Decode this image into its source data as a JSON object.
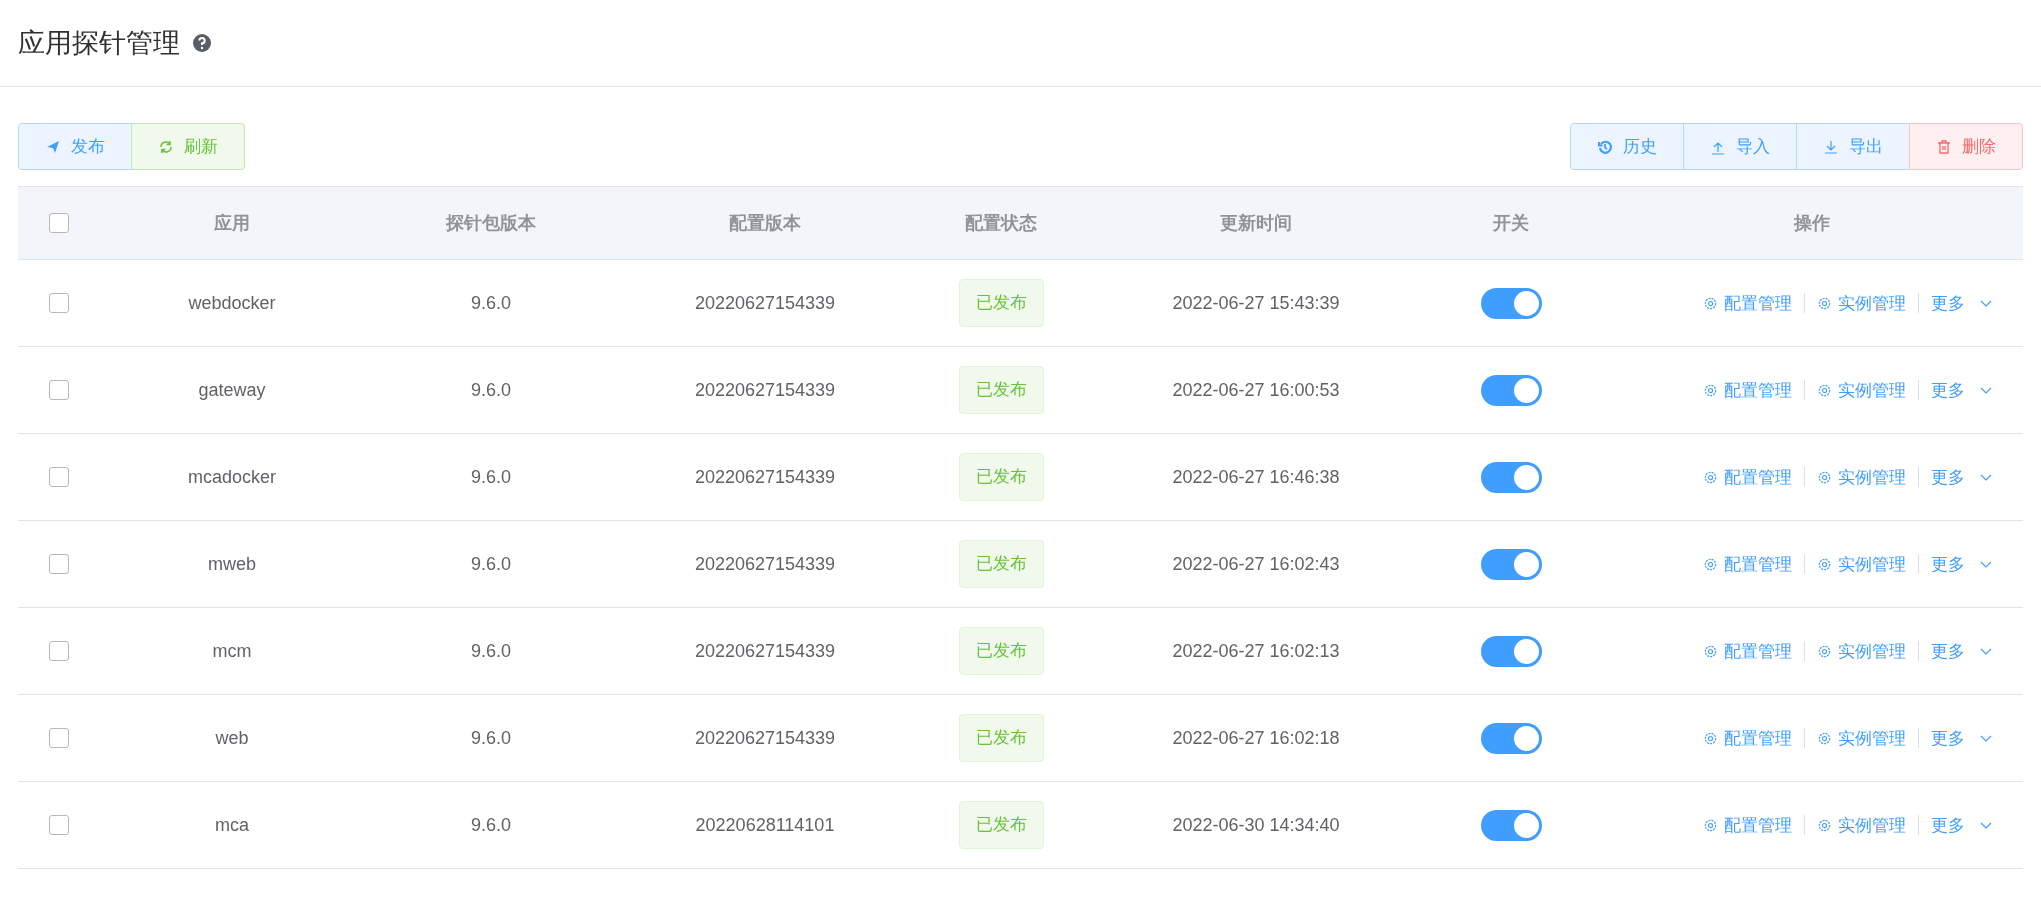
{
  "header": {
    "title": "应用探针管理"
  },
  "toolbar_left": [
    {
      "kind": "publish",
      "label": "发布"
    },
    {
      "kind": "refresh",
      "label": "刷新"
    }
  ],
  "toolbar_right": [
    {
      "kind": "history",
      "label": "历史"
    },
    {
      "kind": "import",
      "label": "导入"
    },
    {
      "kind": "export",
      "label": "导出"
    },
    {
      "kind": "delete",
      "label": "删除"
    }
  ],
  "table": {
    "select_all": {
      "checked": false
    },
    "columns": [
      "应用",
      "探针包版本",
      "配置版本",
      "配置状态",
      "更新时间",
      "开关",
      "操作"
    ],
    "rows": [
      {
        "checked": false,
        "app": "webdocker",
        "probe_version": "9.6.0",
        "config_version": "20220627154339",
        "status": "已发布",
        "updated": "2022-06-27 15:43:39",
        "on": true,
        "actions": [
          "配置管理",
          "实例管理",
          "更多"
        ]
      },
      {
        "checked": false,
        "app": "gateway",
        "probe_version": "9.6.0",
        "config_version": "20220627154339",
        "status": "已发布",
        "updated": "2022-06-27 16:00:53",
        "on": true,
        "actions": [
          "配置管理",
          "实例管理",
          "更多"
        ]
      },
      {
        "checked": false,
        "app": "mcadocker",
        "probe_version": "9.6.0",
        "config_version": "20220627154339",
        "status": "已发布",
        "updated": "2022-06-27 16:46:38",
        "on": true,
        "actions": [
          "配置管理",
          "实例管理",
          "更多"
        ]
      },
      {
        "checked": false,
        "app": "mweb",
        "probe_version": "9.6.0",
        "config_version": "20220627154339",
        "status": "已发布",
        "updated": "2022-06-27 16:02:43",
        "on": true,
        "actions": [
          "配置管理",
          "实例管理",
          "更多"
        ]
      },
      {
        "checked": false,
        "app": "mcm",
        "probe_version": "9.6.0",
        "config_version": "20220627154339",
        "status": "已发布",
        "updated": "2022-06-27 16:02:13",
        "on": true,
        "actions": [
          "配置管理",
          "实例管理",
          "更多"
        ]
      },
      {
        "checked": false,
        "app": "web",
        "probe_version": "9.6.0",
        "config_version": "20220627154339",
        "status": "已发布",
        "updated": "2022-06-27 16:02:18",
        "on": true,
        "actions": [
          "配置管理",
          "实例管理",
          "更多"
        ]
      },
      {
        "checked": false,
        "app": "mca",
        "probe_version": "9.6.0",
        "config_version": "20220628114101",
        "status": "已发布",
        "updated": "2022-06-30 14:34:40",
        "on": true,
        "actions": [
          "配置管理",
          "实例管理",
          "更多"
        ]
      }
    ]
  }
}
